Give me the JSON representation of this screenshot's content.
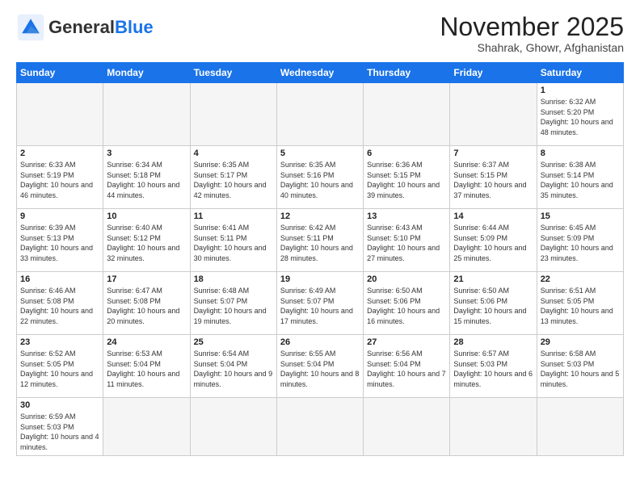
{
  "logo": {
    "general": "General",
    "blue": "Blue"
  },
  "header": {
    "month": "November 2025",
    "subtitle": "Shahrak, Ghowr, Afghanistan"
  },
  "days_of_week": [
    "Sunday",
    "Monday",
    "Tuesday",
    "Wednesday",
    "Thursday",
    "Friday",
    "Saturday"
  ],
  "weeks": [
    [
      {
        "day": "",
        "info": ""
      },
      {
        "day": "",
        "info": ""
      },
      {
        "day": "",
        "info": ""
      },
      {
        "day": "",
        "info": ""
      },
      {
        "day": "",
        "info": ""
      },
      {
        "day": "",
        "info": ""
      },
      {
        "day": "1",
        "info": "Sunrise: 6:32 AM\nSunset: 5:20 PM\nDaylight: 10 hours and 48 minutes."
      }
    ],
    [
      {
        "day": "2",
        "info": "Sunrise: 6:33 AM\nSunset: 5:19 PM\nDaylight: 10 hours and 46 minutes."
      },
      {
        "day": "3",
        "info": "Sunrise: 6:34 AM\nSunset: 5:18 PM\nDaylight: 10 hours and 44 minutes."
      },
      {
        "day": "4",
        "info": "Sunrise: 6:35 AM\nSunset: 5:17 PM\nDaylight: 10 hours and 42 minutes."
      },
      {
        "day": "5",
        "info": "Sunrise: 6:35 AM\nSunset: 5:16 PM\nDaylight: 10 hours and 40 minutes."
      },
      {
        "day": "6",
        "info": "Sunrise: 6:36 AM\nSunset: 5:15 PM\nDaylight: 10 hours and 39 minutes."
      },
      {
        "day": "7",
        "info": "Sunrise: 6:37 AM\nSunset: 5:15 PM\nDaylight: 10 hours and 37 minutes."
      },
      {
        "day": "8",
        "info": "Sunrise: 6:38 AM\nSunset: 5:14 PM\nDaylight: 10 hours and 35 minutes."
      }
    ],
    [
      {
        "day": "9",
        "info": "Sunrise: 6:39 AM\nSunset: 5:13 PM\nDaylight: 10 hours and 33 minutes."
      },
      {
        "day": "10",
        "info": "Sunrise: 6:40 AM\nSunset: 5:12 PM\nDaylight: 10 hours and 32 minutes."
      },
      {
        "day": "11",
        "info": "Sunrise: 6:41 AM\nSunset: 5:11 PM\nDaylight: 10 hours and 30 minutes."
      },
      {
        "day": "12",
        "info": "Sunrise: 6:42 AM\nSunset: 5:11 PM\nDaylight: 10 hours and 28 minutes."
      },
      {
        "day": "13",
        "info": "Sunrise: 6:43 AM\nSunset: 5:10 PM\nDaylight: 10 hours and 27 minutes."
      },
      {
        "day": "14",
        "info": "Sunrise: 6:44 AM\nSunset: 5:09 PM\nDaylight: 10 hours and 25 minutes."
      },
      {
        "day": "15",
        "info": "Sunrise: 6:45 AM\nSunset: 5:09 PM\nDaylight: 10 hours and 23 minutes."
      }
    ],
    [
      {
        "day": "16",
        "info": "Sunrise: 6:46 AM\nSunset: 5:08 PM\nDaylight: 10 hours and 22 minutes."
      },
      {
        "day": "17",
        "info": "Sunrise: 6:47 AM\nSunset: 5:08 PM\nDaylight: 10 hours and 20 minutes."
      },
      {
        "day": "18",
        "info": "Sunrise: 6:48 AM\nSunset: 5:07 PM\nDaylight: 10 hours and 19 minutes."
      },
      {
        "day": "19",
        "info": "Sunrise: 6:49 AM\nSunset: 5:07 PM\nDaylight: 10 hours and 17 minutes."
      },
      {
        "day": "20",
        "info": "Sunrise: 6:50 AM\nSunset: 5:06 PM\nDaylight: 10 hours and 16 minutes."
      },
      {
        "day": "21",
        "info": "Sunrise: 6:50 AM\nSunset: 5:06 PM\nDaylight: 10 hours and 15 minutes."
      },
      {
        "day": "22",
        "info": "Sunrise: 6:51 AM\nSunset: 5:05 PM\nDaylight: 10 hours and 13 minutes."
      }
    ],
    [
      {
        "day": "23",
        "info": "Sunrise: 6:52 AM\nSunset: 5:05 PM\nDaylight: 10 hours and 12 minutes."
      },
      {
        "day": "24",
        "info": "Sunrise: 6:53 AM\nSunset: 5:04 PM\nDaylight: 10 hours and 11 minutes."
      },
      {
        "day": "25",
        "info": "Sunrise: 6:54 AM\nSunset: 5:04 PM\nDaylight: 10 hours and 9 minutes."
      },
      {
        "day": "26",
        "info": "Sunrise: 6:55 AM\nSunset: 5:04 PM\nDaylight: 10 hours and 8 minutes."
      },
      {
        "day": "27",
        "info": "Sunrise: 6:56 AM\nSunset: 5:04 PM\nDaylight: 10 hours and 7 minutes."
      },
      {
        "day": "28",
        "info": "Sunrise: 6:57 AM\nSunset: 5:03 PM\nDaylight: 10 hours and 6 minutes."
      },
      {
        "day": "29",
        "info": "Sunrise: 6:58 AM\nSunset: 5:03 PM\nDaylight: 10 hours and 5 minutes."
      }
    ],
    [
      {
        "day": "30",
        "info": "Sunrise: 6:59 AM\nSunset: 5:03 PM\nDaylight: 10 hours and 4 minutes."
      },
      {
        "day": "",
        "info": ""
      },
      {
        "day": "",
        "info": ""
      },
      {
        "day": "",
        "info": ""
      },
      {
        "day": "",
        "info": ""
      },
      {
        "day": "",
        "info": ""
      },
      {
        "day": "",
        "info": ""
      }
    ]
  ]
}
